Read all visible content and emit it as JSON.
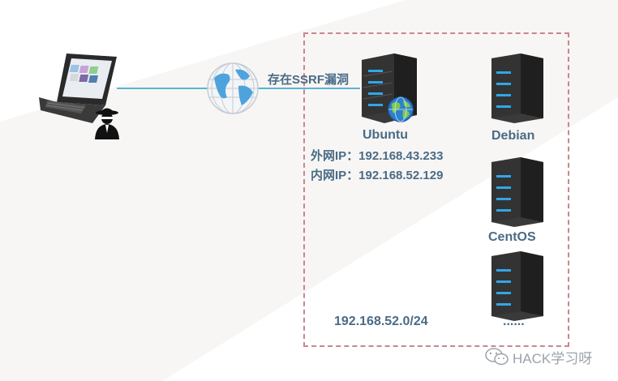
{
  "edge_label": "存在SSRF漏洞",
  "ubuntu": {
    "name": "Ubuntu",
    "external_ip": "外网IP：192.168.43.233",
    "internal_ip": "内网IP：192.168.52.129"
  },
  "servers": [
    {
      "name": "Debian"
    },
    {
      "name": "CentOS"
    },
    {
      "name": "......"
    }
  ],
  "subnet_label": "192.168.52.0/24",
  "watermark": "HACK学习呀",
  "colors": {
    "label_text": "#4a6b86",
    "boundary": "#c9868d",
    "link": "#5bb4d6",
    "server_body": "#2e2e2e",
    "server_led": "#2fa7e8"
  }
}
